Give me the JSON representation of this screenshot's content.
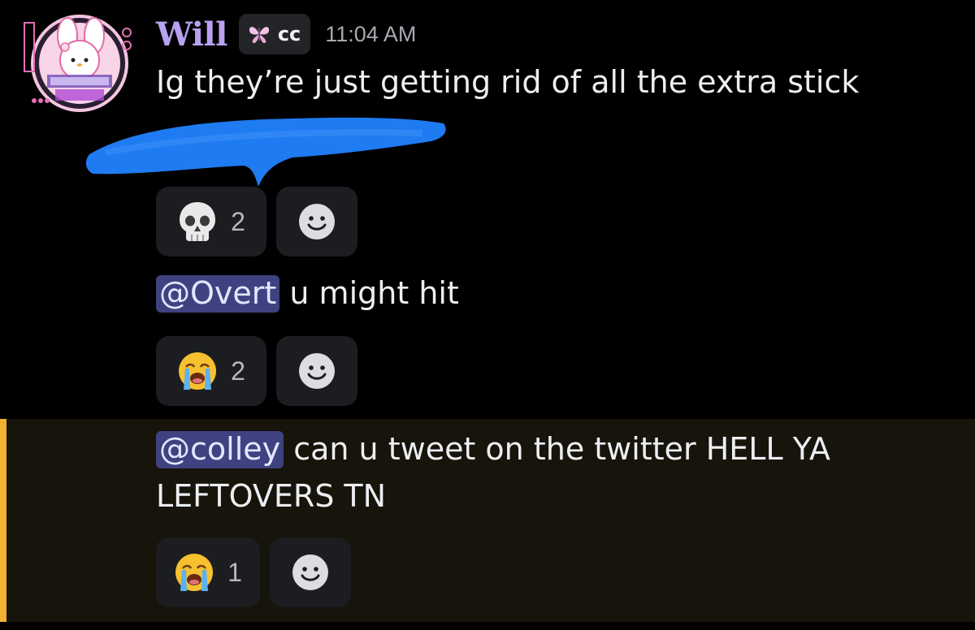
{
  "message": {
    "author": "Will",
    "tag": "cc",
    "timestamp": "11:04 AM",
    "lines": [
      {
        "text": "Ig they’re just getting rid of all the extra stick",
        "reactions": [
          {
            "emoji": "skull",
            "count": "2"
          }
        ]
      },
      {
        "mention": "@Overt",
        "text": " u might hit",
        "reactions": [
          {
            "emoji": "loudly-crying-face",
            "count": "2"
          }
        ]
      },
      {
        "mention": "@colley",
        "text": " can u tweet on the twitter HELL YA LEFTOVERS TN",
        "reactions": [
          {
            "emoji": "loudly-crying-face",
            "count": "1"
          }
        ],
        "highlighted": true
      }
    ]
  },
  "colors": {
    "background": "#000000",
    "username": "#b9a1f2",
    "mention_bg": "#3e4280",
    "highlight_bar": "#f0b232",
    "highlight_bg": "#17140b",
    "scribble": "#1f7bf2",
    "reaction_bg": "#1c1d21"
  }
}
